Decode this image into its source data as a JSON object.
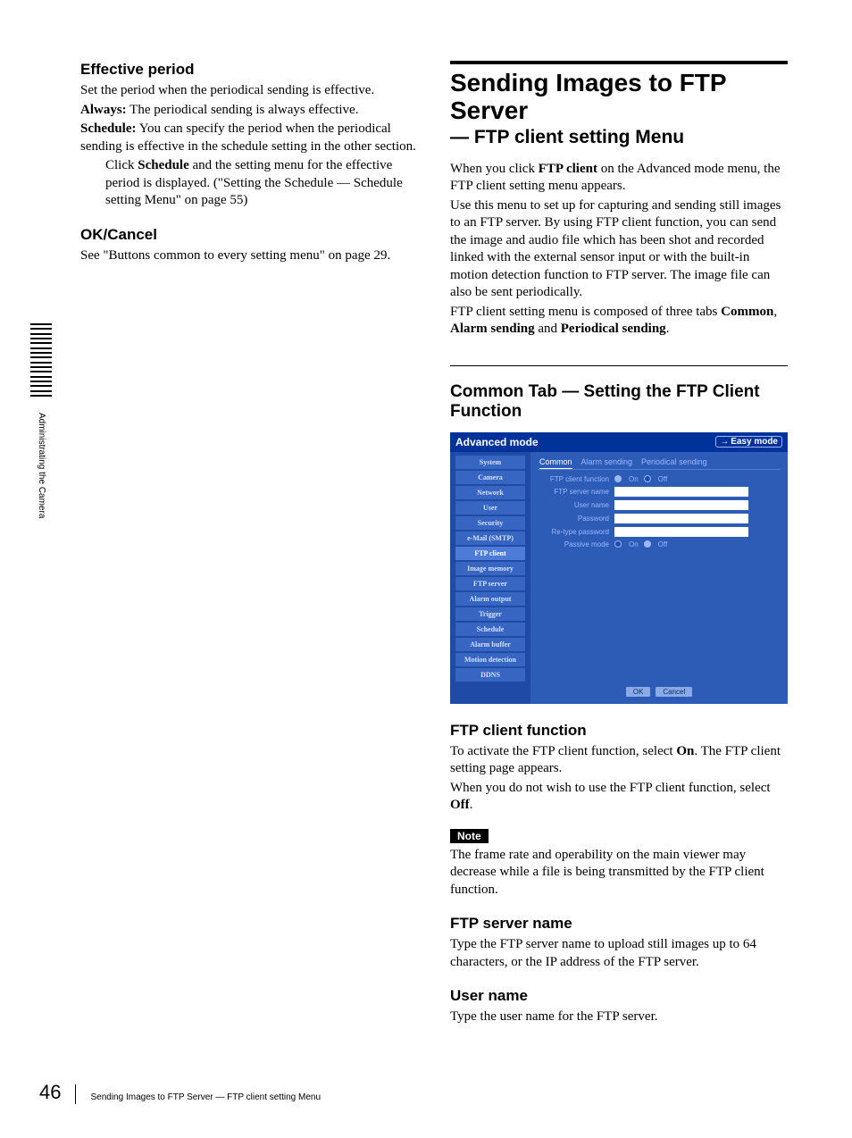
{
  "sideTab": {
    "label": "Administrating the Camera"
  },
  "left": {
    "h_effective": "Effective period",
    "effective_intro": "Set the period when the periodical sending is effective.",
    "always_term": "Always:",
    "always_text": " The periodical sending is always effective.",
    "schedule_term": "Schedule:",
    "schedule_text": " You can specify the period when the periodical sending is effective in the schedule setting in the other section.",
    "schedule_click1": "Click ",
    "schedule_click_bold": "Schedule",
    "schedule_click2": " and the setting menu for the effective period is displayed. (\"Setting the Schedule — Schedule setting Menu\" on page 55)",
    "h_okcancel": "OK/Cancel",
    "okcancel_text": "See \"Buttons common to every setting menu\" on page 29."
  },
  "right": {
    "title": "Sending Images to FTP Server",
    "subtitle": "— FTP client setting Menu",
    "intro1a": "When you click ",
    "intro1bold": "FTP client",
    "intro1b": " on the Advanced mode menu, the FTP client setting menu appears.",
    "intro2": "Use this menu to set up for capturing and sending still images to an FTP server.  By using FTP client function, you can send the image and audio file which has been shot and recorded linked with the external sensor input or with the built-in motion detection function to FTP server. The image file can also be sent periodically.",
    "intro3a": "FTP client setting menu is composed of three tabs ",
    "intro3_common": "Common",
    "intro3_sep1": ", ",
    "intro3_alarm": "Alarm sending",
    "intro3_sep2": " and ",
    "intro3_periodical": "Periodical sending",
    "intro3_end": ".",
    "h_commontab": "Common Tab — Setting the FTP Client Function",
    "shot": {
      "modeTitle": "Advanced mode",
      "easyMode": "Easy mode",
      "sidebar": [
        "System",
        "Camera",
        "Network",
        "User",
        "Security",
        "e-Mail (SMTP)",
        "FTP client",
        "Image memory",
        "FTP server",
        "Alarm output",
        "Trigger",
        "Schedule",
        "Alarm buffer",
        "Motion detection",
        "DDNS"
      ],
      "sidebarSelectedIndex": 6,
      "tabs": [
        "Common",
        "Alarm sending",
        "Periodical sending"
      ],
      "tabSelectedIndex": 0,
      "rowFunc": "FTP client function",
      "rowFuncOn": "On",
      "rowFuncOff": "Off",
      "rowServer": "FTP server name",
      "rowUser": "User name",
      "rowPass": "Password",
      "rowRePass": "Re-type password",
      "rowPassive": "Passive mode",
      "passiveOn": "On",
      "passiveOff": "Off",
      "btnOK": "OK",
      "btnCancel": "Cancel"
    },
    "h_ftpfunc": "FTP client function",
    "ftpfunc_p1a": "To activate the FTP client function, select ",
    "ftpfunc_p1bold": "On",
    "ftpfunc_p1b": ".  The FTP client setting page appears.",
    "ftpfunc_p2a": "When you do not wish to use the FTP client function, select ",
    "ftpfunc_p2bold": "Off",
    "ftpfunc_p2b": ".",
    "note_label": "Note",
    "note_text": "The frame rate and operability on the main viewer may decrease while a file is being transmitted by the FTP client function.",
    "h_ftpserver": "FTP server name",
    "ftpserver_text": "Type the FTP server name to upload still images up to 64 characters, or the IP address of the FTP server.",
    "h_username": "User name",
    "username_text": "Type the user name for the FTP server."
  },
  "footer": {
    "pageNumber": "46",
    "crumb": "Sending Images to FTP Server — FTP client setting Menu"
  }
}
